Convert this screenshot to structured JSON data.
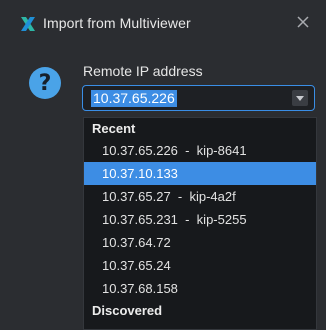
{
  "window": {
    "title": "Import from Multiviewer",
    "accent_color": "#3d8de4"
  },
  "form": {
    "field_label": "Remote IP address",
    "current_value": "10.37.65.226"
  },
  "dropdown": {
    "recent_header": "Recent",
    "recent_items": [
      "10.37.65.226  -  kip-8641",
      "10.37.10.133",
      "10.37.65.27  -  kip-4a2f",
      "10.37.65.231  -  kip-5255",
      "10.37.64.72",
      "10.37.65.24",
      "10.37.68.158"
    ],
    "selected_index": 1,
    "discovered_header": "Discovered"
  },
  "icons": {
    "app": "app-logo-icon",
    "close": "close-icon",
    "help": "question-mark-icon",
    "dropdown": "chevron-down-icon"
  }
}
